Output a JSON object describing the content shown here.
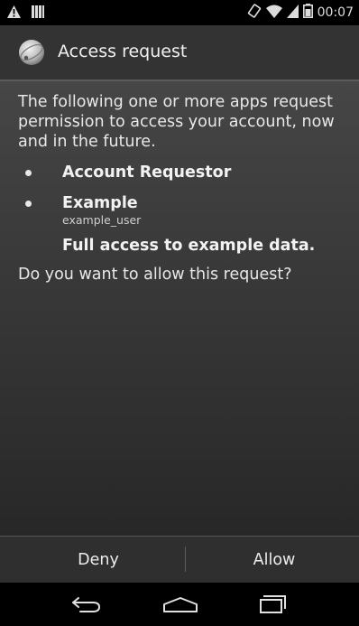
{
  "status_bar": {
    "time": "00:07",
    "icons": [
      "warning-icon",
      "notification-icon",
      "rotate-icon",
      "wifi-icon",
      "signal-icon",
      "battery-icon"
    ]
  },
  "dialog": {
    "title": "Access request",
    "icon": "account-globe-icon",
    "intro": "The following one or more apps request permission to access your account, now and in the future.",
    "apps": [
      {
        "name": "Account Requestor",
        "user": ""
      },
      {
        "name": "Example",
        "user": "example_user"
      }
    ],
    "permission": "Full access to example data.",
    "question": "Do you want to allow this request?",
    "buttons": {
      "deny": "Deny",
      "allow": "Allow"
    }
  },
  "nav_bar": {
    "icons": [
      "back-icon",
      "home-icon",
      "recent-apps-icon"
    ]
  },
  "colors": {
    "background_top": "#4a4a4a",
    "background_bottom": "#232323",
    "text": "#e8e8e8"
  }
}
